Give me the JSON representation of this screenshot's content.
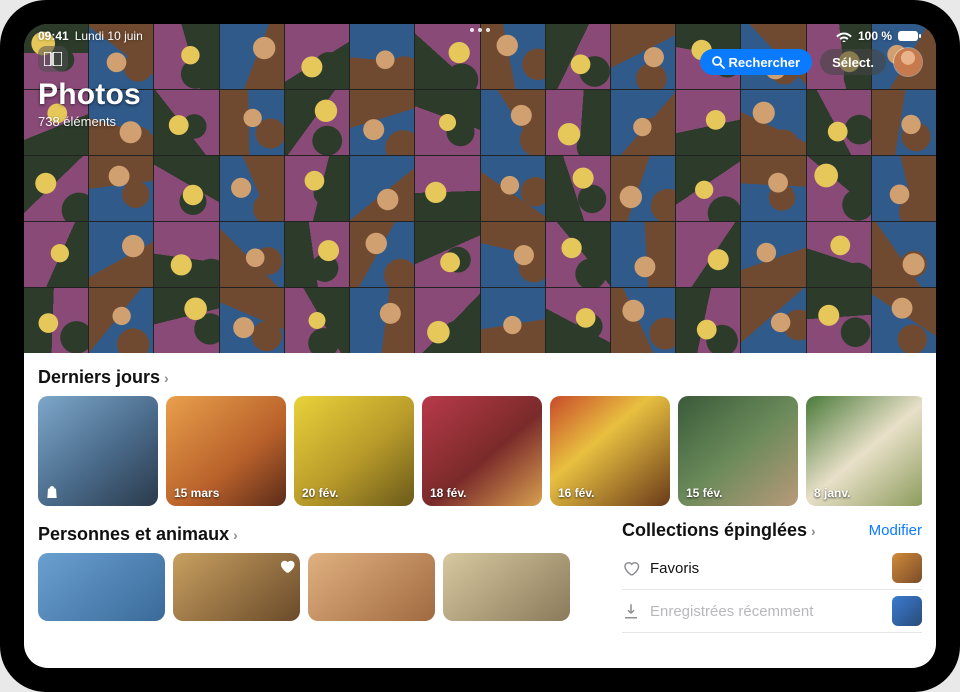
{
  "status": {
    "time": "09:41",
    "date": "Lundi 10 juin",
    "battery": "100 %"
  },
  "header": {
    "title": "Photos",
    "subtitle": "738 éléments",
    "search_label": "Rechercher",
    "select_label": "Sélect."
  },
  "sections": {
    "recent_days": {
      "title": "Derniers jours",
      "items": [
        {
          "label": ""
        },
        {
          "label": "15 mars"
        },
        {
          "label": "20 fév."
        },
        {
          "label": "18 fév."
        },
        {
          "label": "16 fév."
        },
        {
          "label": "15 fév."
        },
        {
          "label": "8 janv."
        }
      ]
    },
    "people_pets": {
      "title": "Personnes et animaux"
    },
    "pinned": {
      "title": "Collections épinglées",
      "edit": "Modifier",
      "rows": [
        {
          "label": "Favoris"
        },
        {
          "label": "Enregistrées récemment"
        }
      ]
    }
  },
  "grid": {
    "rows": 5,
    "cols": 14
  },
  "palettes": [
    [
      "#2e5a3b",
      "#d9c487",
      "#7a3b26"
    ],
    [
      "#c77a4c",
      "#f0d7b0",
      "#4a5a66"
    ],
    [
      "#3a6fa0",
      "#d8b36a",
      "#734028"
    ],
    [
      "#8a4a78",
      "#e6c85a",
      "#2c3b2a"
    ],
    [
      "#b85a2a",
      "#f0e0c0",
      "#556070"
    ],
    [
      "#2b6a7a",
      "#d89a5a",
      "#3d2c24"
    ],
    [
      "#7a2c2c",
      "#d8c070",
      "#4a6a3a"
    ],
    [
      "#3a7a5a",
      "#e0a060",
      "#705040"
    ],
    [
      "#5a3a7a",
      "#f0c860",
      "#2a4a6a"
    ],
    [
      "#a05a30",
      "#e8d8a8",
      "#506a40"
    ],
    [
      "#305a8a",
      "#d0a070",
      "#704a30"
    ],
    [
      "#6a3a30",
      "#e8c878",
      "#3a6a5a"
    ],
    [
      "#8a5a2a",
      "#f0e0b8",
      "#405a6a"
    ],
    [
      "#2a4a3a",
      "#d8b060",
      "#7a5040"
    ]
  ],
  "day_bgs": [
    "linear-gradient(140deg,#7da7c9 0%,#4a6a8a 55%,#2a3a4a 100%)",
    "linear-gradient(140deg,#e9a04c 0%,#b8602a 60%,#5a2c1a 100%)",
    "linear-gradient(140deg,#e8d23a 0%,#b89a2a 55%,#6a5a1a 100%)",
    "linear-gradient(140deg,#b83a4a 0%,#7a2a2a 55%,#d8a050 100%)",
    "linear-gradient(140deg,#c84a2a 0%,#e8c040 40%,#6a3a1a 100%)",
    "linear-gradient(140deg,#3a5a3a 0%,#6a8a5a 50%,#b89a7a 100%)",
    "linear-gradient(140deg,#4a7a3a 0%,#e8e0c8 50%,#8a9a5a 100%)"
  ],
  "people_bgs": [
    "linear-gradient(140deg,#6aa0d0,#3a6a9a)",
    "linear-gradient(140deg,#c8a060,#6a4a2a)",
    "linear-gradient(140deg,#e0b080,#a06a40)",
    "linear-gradient(140deg,#d8c8a0,#8a7a5a)"
  ]
}
